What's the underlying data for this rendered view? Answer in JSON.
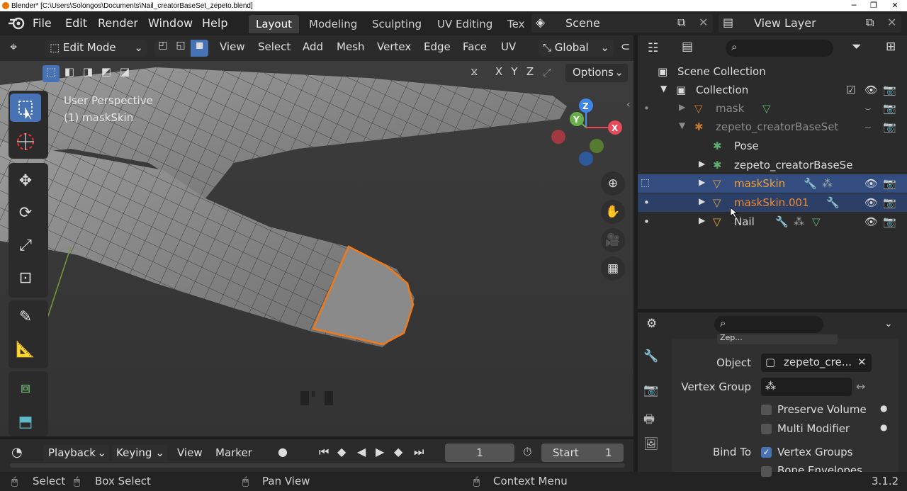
{
  "window": {
    "title": "Blender* [C:\\Users\\Solongos\\Documents\\Nail_creatorBaseSet_zepeto.blend]",
    "version": "3.1.2"
  },
  "menu": {
    "file": "File",
    "edit": "Edit",
    "render": "Render",
    "window": "Window",
    "help": "Help"
  },
  "workspaces": {
    "layout": "Layout",
    "modeling": "Modeling",
    "sculpting": "Sculpting",
    "uv_editing": "UV Editing",
    "texture": "Tex"
  },
  "scene": {
    "name": "Scene"
  },
  "view_layer": {
    "name": "View Layer"
  },
  "viewport_header": {
    "mode": "Edit Mode",
    "view": "View",
    "select": "Select",
    "add": "Add",
    "mesh": "Mesh",
    "vertex": "Vertex",
    "edge": "Edge",
    "face": "Face",
    "uv": "UV",
    "transform": "Global",
    "options": "Options",
    "axis_x": "X",
    "axis_y": "Y",
    "axis_z": "Z"
  },
  "viewport": {
    "perspective": "User Perspective",
    "object": "(1) maskSkin",
    "gizmo_z": "Z",
    "gizmo_y": "Y",
    "gizmo_x": "X"
  },
  "outliner": {
    "scene_collection": "Scene Collection",
    "collection": "Collection",
    "rows": [
      {
        "label": "mask"
      },
      {
        "label": "zepeto_creatorBaseSet"
      },
      {
        "label": "Pose"
      },
      {
        "label": "zepeto_creatorBaseSe"
      },
      {
        "label": "maskSkin"
      },
      {
        "label": "maskSkin.001"
      },
      {
        "label": "Nail"
      }
    ]
  },
  "properties": {
    "object_label": "Object",
    "object_value": "zepeto_cre...",
    "vertex_group_label": "Vertex Group",
    "preserve_volume": "Preserve Volume",
    "multi_modifier": "Multi Modifier",
    "bind_to_label": "Bind To",
    "vertex_groups": "Vertex Groups",
    "bone_envelopes": "Bone Envelopes",
    "top_field": "Zep..."
  },
  "timeline": {
    "playback": "Playback",
    "keying": "Keying",
    "view": "View",
    "marker": "Marker",
    "current_frame": "1",
    "start_label": "Start",
    "start_value": "1"
  },
  "statusbar": {
    "select": "Select",
    "box_select": "Box Select",
    "pan_view": "Pan View",
    "context_menu": "Context Menu"
  },
  "colors": {
    "accent_blue": "#4772b3",
    "selection_orange": "#f07a1a",
    "object_orange": "#e8a43a"
  }
}
